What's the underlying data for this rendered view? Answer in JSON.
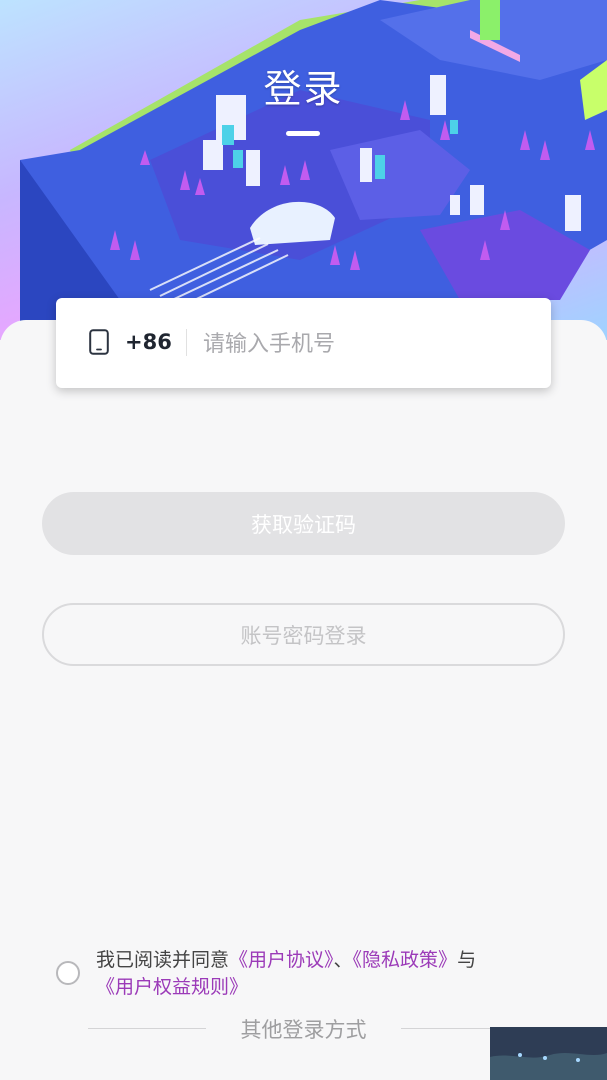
{
  "header": {
    "title": "登录"
  },
  "phone": {
    "country_code": "+86",
    "placeholder": "请输入手机号",
    "value": ""
  },
  "buttons": {
    "get_code": "获取验证码",
    "password_login": "账号密码登录"
  },
  "agreement": {
    "prefix": "我已阅读并同意",
    "user_agreement": "《用户协议》",
    "separator": "、",
    "privacy_policy": "《隐私政策》",
    "joiner": "与",
    "user_rights": "《用户权益规则》",
    "checked": false
  },
  "other_login": {
    "label": "其他登录方式"
  },
  "colors": {
    "link": "#9b3ab8",
    "disabled_button": "#e2e2e4",
    "text_dark": "#1f2530"
  }
}
